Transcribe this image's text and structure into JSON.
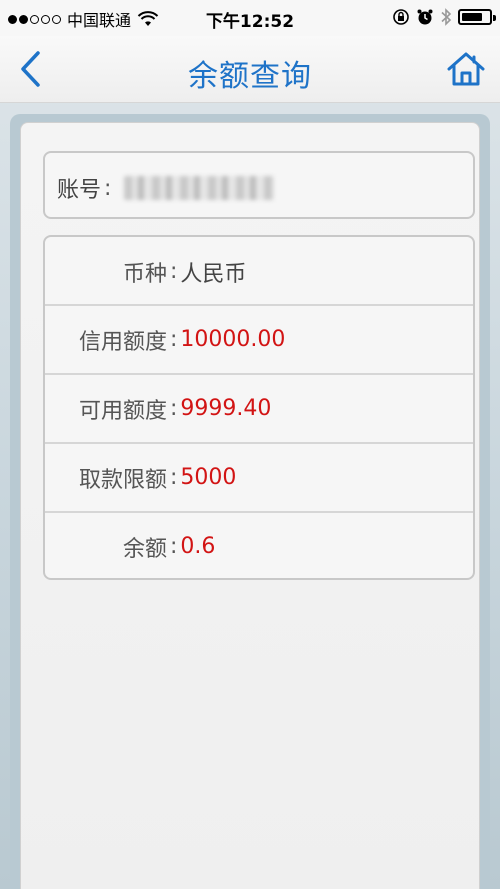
{
  "status_bar": {
    "carrier": "中国联通",
    "time": "下午12:52"
  },
  "nav": {
    "title": "余额查询"
  },
  "account": {
    "label": "账号",
    "colon": ":"
  },
  "details": [
    {
      "label": "币种",
      "colon": ":",
      "value": "人民币",
      "highlight": false
    },
    {
      "label": "信用额度",
      "colon": ":",
      "value": "10000.00",
      "highlight": true
    },
    {
      "label": "可用额度",
      "colon": ":",
      "value": "9999.40",
      "highlight": true
    },
    {
      "label": "取款限额",
      "colon": ":",
      "value": "5000",
      "highlight": true
    },
    {
      "label": "余额",
      "colon": ":",
      "value": "0.6",
      "highlight": true
    }
  ],
  "colors": {
    "accent": "#1e73c8",
    "value_red": "#d21414"
  },
  "icons": [
    "signal-dots-icon",
    "wifi-icon",
    "orientation-lock-icon",
    "alarm-icon",
    "bluetooth-icon",
    "battery-icon",
    "back-chevron-icon",
    "home-icon"
  ]
}
